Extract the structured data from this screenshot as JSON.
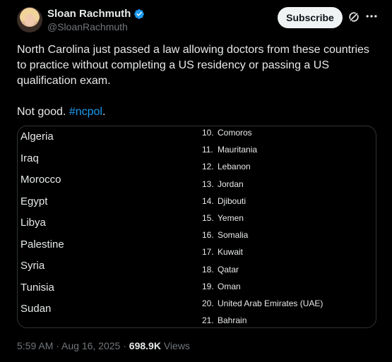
{
  "author": {
    "name": "Sloan Rachmuth",
    "handle": "@SloanRachmuth"
  },
  "actions": {
    "subscribe_label": "Subscribe"
  },
  "tweet": {
    "line1": "North Carolina just passed a law allowing doctors from these countries",
    "line2": "to practice without completing a US residency or passing a US",
    "line3": "qualification exam.",
    "line4_prefix": "Not good. ",
    "hashtag": "#ncpol",
    "line4_suffix": "."
  },
  "image": {
    "left_countries": [
      "Algeria",
      "Iraq",
      "Morocco",
      "Egypt",
      "Libya",
      "Palestine",
      "Syria",
      "Tunisia",
      "Sudan"
    ],
    "right_countries": [
      {
        "num": "10.",
        "name": "Comoros"
      },
      {
        "num": "11.",
        "name": "Mauritania"
      },
      {
        "num": "12.",
        "name": "Lebanon"
      },
      {
        "num": "13.",
        "name": "Jordan"
      },
      {
        "num": "14.",
        "name": "Djibouti"
      },
      {
        "num": "15.",
        "name": "Yemen"
      },
      {
        "num": "16.",
        "name": "Somalia"
      },
      {
        "num": "17.",
        "name": "Kuwait"
      },
      {
        "num": "18.",
        "name": "Qatar"
      },
      {
        "num": "19.",
        "name": "Oman"
      },
      {
        "num": "20.",
        "name": "United Arab Emirates (UAE)"
      },
      {
        "num": "21.",
        "name": "Bahrain"
      }
    ]
  },
  "meta": {
    "timestamp": "5:59 AM · Aug 16, 2025",
    "separator": " · ",
    "views_count": "698.9K",
    "views_label": " Views"
  },
  "colors": {
    "background": "#000000",
    "text": "#e7e9ea",
    "muted": "#71767b",
    "link": "#1d9bf0",
    "verified": "#1d9bf0"
  }
}
